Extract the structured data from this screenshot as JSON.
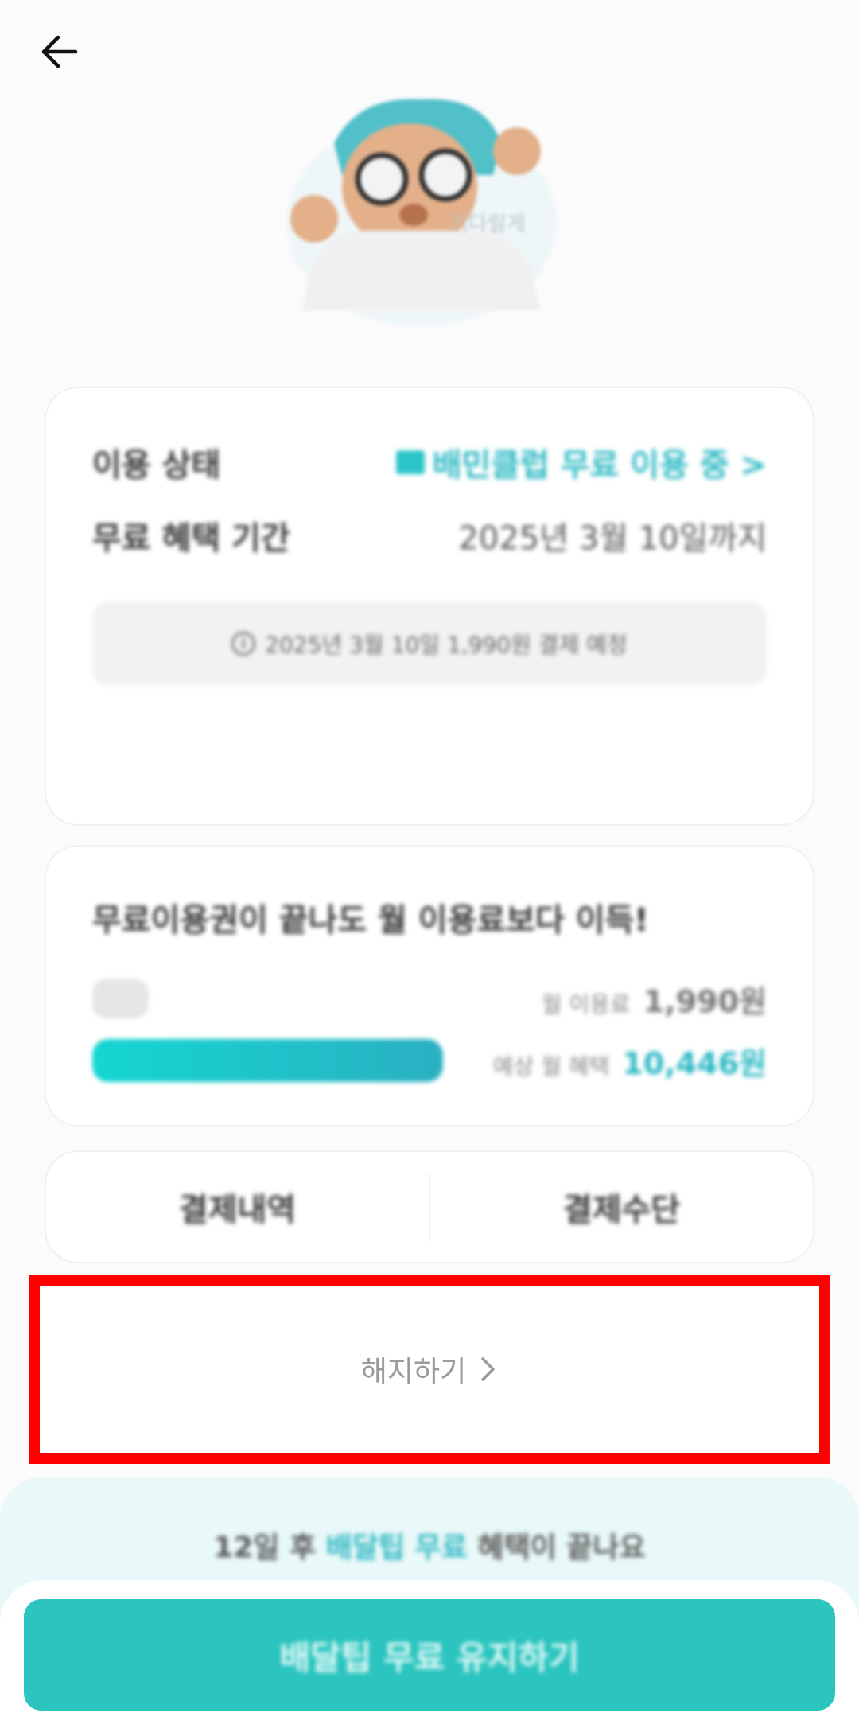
{
  "status": {
    "label": "이용 상태",
    "value": "배민클럽 무료 이용 중 >"
  },
  "period": {
    "label": "무료 혜택 기간",
    "value": "2025년 3월 10일까지"
  },
  "notice": "2025년 3월 10일 1,990원 결제 예정",
  "benefit": {
    "title": "무료이용권이 끝나도 월 이용료보다 이득!",
    "fee_label": "월 이용료",
    "fee_amount": "1,990원",
    "expected_label": "예상 월 혜택",
    "expected_amount": "10,446원",
    "fee_bar_fraction": 0.084,
    "benefit_bar_fraction": 0.52
  },
  "payment": {
    "history": "결제내역",
    "method": "결제수단"
  },
  "cancel": {
    "label": "해지하기",
    "chevron": "chevron-right-icon"
  },
  "bottom": {
    "prefix": "12일 후 ",
    "highlight": "배달팁 무료",
    "suffix": " 혜택이 끝나요",
    "cta": "배달팁 무료 유지하기"
  },
  "hero_text": "기다릴게",
  "colors": {
    "accent": "#2bb8c3",
    "cta": "#2bc4be",
    "highlight_border": "#ff0000"
  }
}
